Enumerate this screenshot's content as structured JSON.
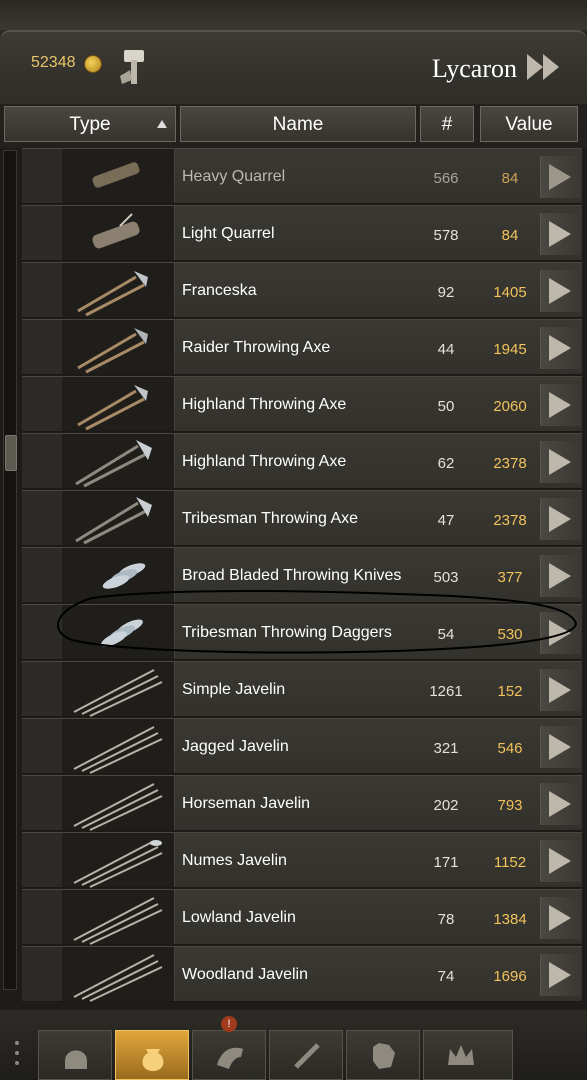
{
  "header": {
    "gold_amount": "52348",
    "shop_name": "Lycaron"
  },
  "columns": {
    "type": "Type",
    "name": "Name",
    "qty": "#",
    "value": "Value"
  },
  "items": [
    {
      "name": "Heavy Quarrel",
      "qty": "566",
      "value": "84"
    },
    {
      "name": "Light Quarrel",
      "qty": "578",
      "value": "84"
    },
    {
      "name": "Franceska",
      "qty": "92",
      "value": "1405"
    },
    {
      "name": "Raider Throwing Axe",
      "qty": "44",
      "value": "1945"
    },
    {
      "name": "Highland Throwing Axe",
      "qty": "50",
      "value": "2060"
    },
    {
      "name": "Highland Throwing Axe",
      "qty": "62",
      "value": "2378"
    },
    {
      "name": "Tribesman Throwing Axe",
      "qty": "47",
      "value": "2378"
    },
    {
      "name": "Broad Bladed Throwing Knives",
      "qty": "503",
      "value": "377"
    },
    {
      "name": "Tribesman Throwing Daggers",
      "qty": "54",
      "value": "530"
    },
    {
      "name": "Simple Javelin",
      "qty": "1261",
      "value": "152"
    },
    {
      "name": "Jagged Javelin",
      "qty": "321",
      "value": "546"
    },
    {
      "name": "Horseman Javelin",
      "qty": "202",
      "value": "793"
    },
    {
      "name": "Numes Javelin",
      "qty": "171",
      "value": "1152"
    },
    {
      "name": "Lowland Javelin",
      "qty": "78",
      "value": "1384"
    },
    {
      "name": "Woodland Javelin",
      "qty": "74",
      "value": "1696"
    }
  ],
  "bottom_tabs": [
    {
      "icon": "helmet-icon"
    },
    {
      "icon": "goods-bag-icon"
    },
    {
      "icon": "horse-icon"
    },
    {
      "icon": "weapon-icon"
    },
    {
      "icon": "wolf-banner-icon"
    },
    {
      "icon": "crown-icon"
    }
  ],
  "alert_badge": "!"
}
